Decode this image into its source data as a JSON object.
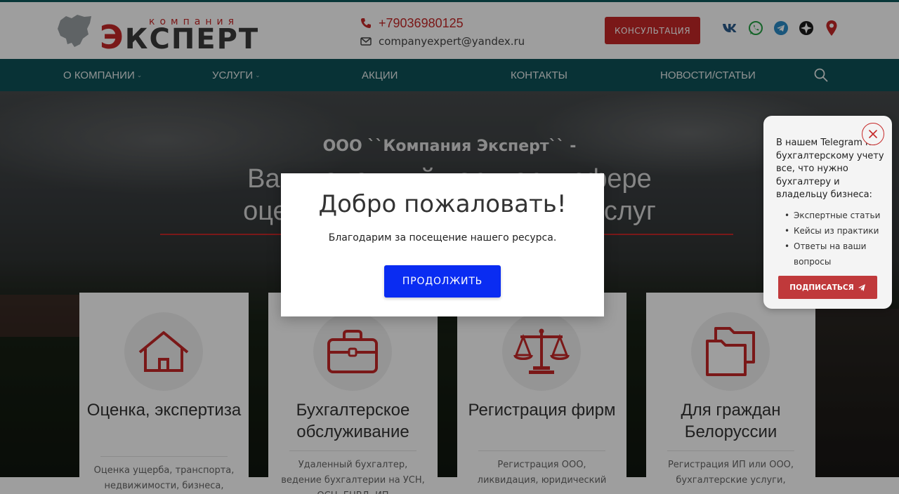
{
  "header": {
    "logo_small": "компания",
    "logo_first_letter": "Э",
    "logo_rest": "КСПЕРТ",
    "phone": "+79036980125",
    "email": "companyexpert@yandex.ru",
    "consult_label": "КОНСУЛЬТАЦИЯ",
    "socials": [
      "vk-icon",
      "whatsapp-icon",
      "telegram-icon",
      "messenger-icon",
      "location-pin-icon"
    ]
  },
  "nav": {
    "items": [
      {
        "label": "О КОМПАНИИ",
        "chevron": "⌄"
      },
      {
        "label": "УСЛУГИ",
        "chevron": "⌄"
      },
      {
        "label": "АКЦИИ"
      },
      {
        "label": "КОНТАКТЫ"
      },
      {
        "label": "НОВОСТИ/СТАТЬИ"
      }
    ]
  },
  "hero": {
    "subtitle": "ООО ``Компания Эксперт`` -",
    "title_line1": "Ваш надежный партнер в сфере",
    "title_line2": "оценочных и бухгалтерских услуг"
  },
  "cards": [
    {
      "icon": "house-icon",
      "title": "Оценка, экспертиза",
      "desc": "Оценка ущерба, транспорта, недвижимости, бизнеса,"
    },
    {
      "icon": "briefcase-icon",
      "title": "Бухгалтерское обслуживание",
      "desc": "Удаленный бухгалтер, ведение бухгалтерии на УСН, ОСН, ЕНВД, ИП"
    },
    {
      "icon": "scales-icon",
      "title": "Регистрация фирм",
      "desc": "Регистрация ООО, ликвидация, юридический"
    },
    {
      "icon": "folders-icon",
      "title": "Для граждан Белоруссии",
      "desc": "Регистрация ИП или ООО, бухгалтерские услуги,"
    }
  ],
  "modal": {
    "title": "Добро пожаловать!",
    "text": "Благодарим за посещение нашего ресурса.",
    "button": "ПРОДОЛЖИТЬ"
  },
  "telegram_popup": {
    "text": "В нашем Telegram по бухгалтерскому учету все, что нужно бухгалтеру и владельцу бизнеса:",
    "items": [
      "Экспертные статьи",
      "Кейсы из практики",
      "Ответы на ваши вопросы"
    ],
    "button": "ПОДПИСАТЬСЯ"
  },
  "colors": {
    "brand_red": "#c62828",
    "nav_teal": "#0d5257",
    "modal_button_blue": "#0a2cf2"
  }
}
